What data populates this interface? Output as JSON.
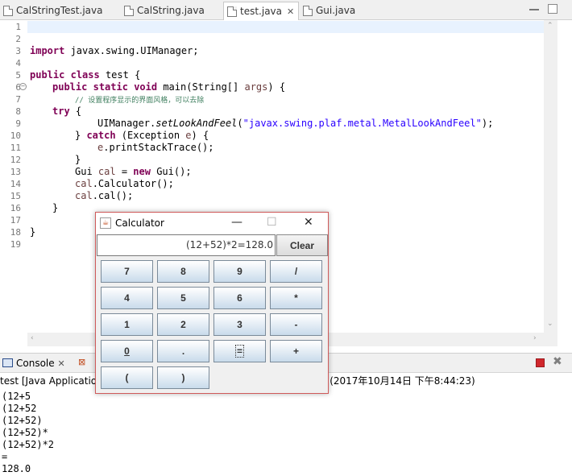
{
  "editor_tabs": [
    {
      "label": "CalStringTest.java",
      "active": false
    },
    {
      "label": "CalString.java",
      "active": false
    },
    {
      "label": "test.java",
      "active": true,
      "close": "✕"
    },
    {
      "label": "Gui.java",
      "active": false
    }
  ],
  "line_numbers": [
    "1",
    "2",
    "3",
    "4",
    "5",
    "6",
    "7",
    "8",
    "9",
    "10",
    "11",
    "12",
    "13",
    "14",
    "15",
    "16",
    "17",
    "18",
    "19"
  ],
  "code": {
    "l3_kw": "import",
    "l3_rest": " javax.swing.UIManager;",
    "l5_kw1": "public",
    "l5_kw2": "class",
    "l5_rest": " test {",
    "l6_kw1": "public",
    "l6_kw2": "static",
    "l6_kw3": "void",
    "l6_rest1": " main(String[] ",
    "l6_param": "args",
    "l6_rest2": ") {",
    "l7_comment": "// 设置程序显示的界面风格，可以去除",
    "l8_kw": "try",
    "l8_rest": " {",
    "l9_pre": "UIManager.",
    "l9_method": "setLookAndFeel",
    "l9_open": "(",
    "l9_string": "\"javax.swing.plaf.metal.MetalLookAndFeel\"",
    "l9_close": ");",
    "l10_pre": "} ",
    "l10_kw": "catch",
    "l10_mid": " (Exception ",
    "l10_var": "e",
    "l10_rest": ") {",
    "l11_var": "e",
    "l11_rest": ".printStackTrace();",
    "l12": "}",
    "l13_pre": "Gui ",
    "l13_var": "cal",
    "l13_mid": " = ",
    "l13_kw": "new",
    "l13_rest": " Gui();",
    "l14_var": "cal",
    "l14_rest": ".Calculator();",
    "l15_var": "cal",
    "l15_rest": ".cal();",
    "l16": "}",
    "l18": "}"
  },
  "console": {
    "tab_label": "Console",
    "close": "✕",
    "terminated_prefix": "test [Java Application",
    "terminated_suffix": "e (2017年10月14日 下午8:44:23)",
    "output": [
      "(12+5",
      "(12+52",
      "(12+52)",
      "(12+52)*",
      "(12+52)*2",
      "=",
      "128.0"
    ]
  },
  "calculator": {
    "title": "Calculator",
    "minimize": "—",
    "maximize": "☐",
    "close": "✕",
    "display": "(12+52)*2=128.0",
    "clear": "Clear",
    "buttons": [
      "7",
      "8",
      "9",
      "/",
      "4",
      "5",
      "6",
      "*",
      "1",
      "2",
      "3",
      "-",
      "0",
      ".",
      "=",
      "+",
      "(",
      ")"
    ]
  },
  "colors": {
    "keyword": "#7f0055",
    "string": "#2a00ff",
    "comment": "#3f7f5f",
    "field": "#0000c0",
    "current_line": "#e8f2fe",
    "window_border": "#cf5a5a"
  }
}
